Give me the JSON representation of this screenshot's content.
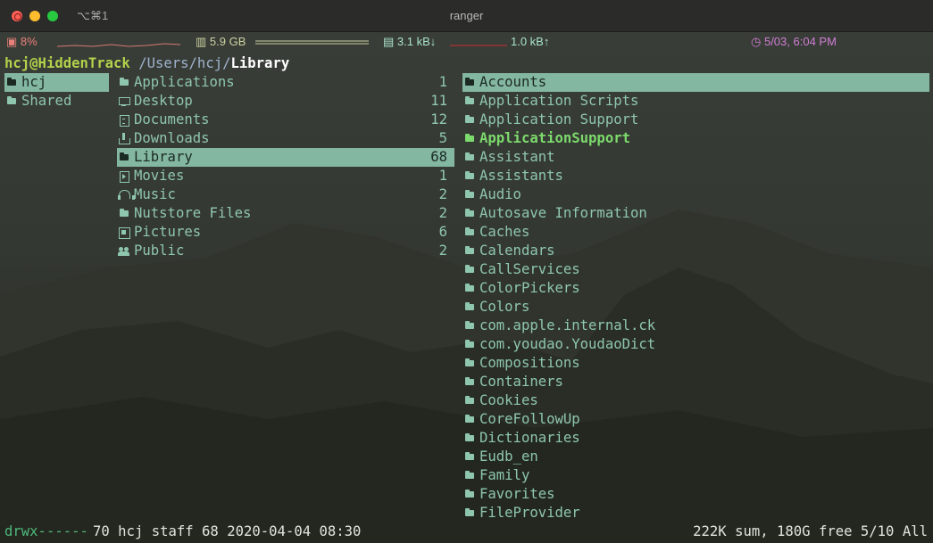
{
  "window": {
    "shortcut": "⌥⌘1",
    "title": "ranger"
  },
  "status": {
    "cpu": "8%",
    "memory": "5.9 GB",
    "net_down": "3.1 kB↓",
    "net_up": "1.0 kB↑",
    "clock": "5/03, 6:04 PM"
  },
  "path": {
    "host": "hcj@HiddenTrack",
    "dir": "/Users/hcj/",
    "leaf": "Library"
  },
  "parent_column": [
    {
      "icon": "folder-icon",
      "name": "hcj",
      "selected": true
    },
    {
      "icon": "folder-icon",
      "name": "Shared",
      "selected": false
    }
  ],
  "current_column": [
    {
      "icon": "folder-icon",
      "name": "Applications",
      "count": "1"
    },
    {
      "icon": "monitor-icon",
      "name": "Desktop",
      "count": "11"
    },
    {
      "icon": "document-icon",
      "name": "Documents",
      "count": "12"
    },
    {
      "icon": "download-icon",
      "name": "Downloads",
      "count": "5"
    },
    {
      "icon": "folder-icon",
      "name": "Library",
      "count": "68",
      "selected": true
    },
    {
      "icon": "movie-icon",
      "name": "Movies",
      "count": "1"
    },
    {
      "icon": "headphones-icon",
      "name": "Music",
      "count": "2"
    },
    {
      "icon": "folder-icon",
      "name": "Nutstore Files",
      "count": "2"
    },
    {
      "icon": "picture-icon",
      "name": "Pictures",
      "count": "6"
    },
    {
      "icon": "people-icon",
      "name": "Public",
      "count": "2"
    }
  ],
  "preview_column": [
    {
      "name": "Accounts",
      "selected": true
    },
    {
      "name": "Application Scripts"
    },
    {
      "name": "Application Support"
    },
    {
      "name": "ApplicationSupport",
      "highlight": true
    },
    {
      "name": "Assistant"
    },
    {
      "name": "Assistants"
    },
    {
      "name": "Audio"
    },
    {
      "name": "Autosave Information"
    },
    {
      "name": "Caches"
    },
    {
      "name": "Calendars"
    },
    {
      "name": "CallServices"
    },
    {
      "name": "ColorPickers"
    },
    {
      "name": "Colors"
    },
    {
      "name": "com.apple.internal.ck"
    },
    {
      "name": "com.youdao.YoudaoDict"
    },
    {
      "name": "Compositions"
    },
    {
      "name": "Containers"
    },
    {
      "name": "Cookies"
    },
    {
      "name": "CoreFollowUp"
    },
    {
      "name": "Dictionaries"
    },
    {
      "name": "Eudb_en"
    },
    {
      "name": "Family"
    },
    {
      "name": "Favorites"
    },
    {
      "name": "FileProvider"
    }
  ],
  "footer": {
    "permissions": "drwx------",
    "meta": "70 hcj staff 68 2020-04-04 08:30",
    "summary": "222K sum, 180G free  5/10  All"
  }
}
